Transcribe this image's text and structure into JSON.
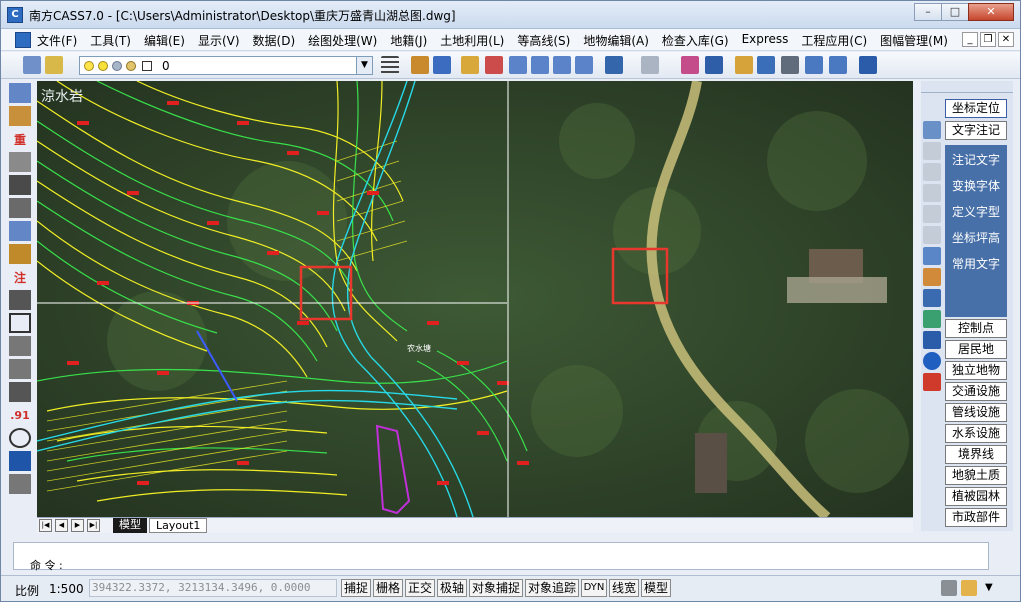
{
  "window": {
    "title": "南方CASS7.0 - [C:\\Users\\Administrator\\Desktop\\重庆万盛青山湖总图.dwg]",
    "controls": {
      "minimize": "–",
      "maximize": "□",
      "close": "✕"
    }
  },
  "menubar": {
    "items": [
      "文件(F)",
      "工具(T)",
      "编辑(E)",
      "显示(V)",
      "数据(D)",
      "绘图处理(W)",
      "地籍(J)",
      "土地利用(L)",
      "等高线(S)",
      "地物编辑(A)",
      "检查入库(G)",
      "Express",
      "工程应用(C)",
      "图幅管理(M)"
    ],
    "mdi": [
      "_",
      "❐",
      "✕"
    ]
  },
  "toolbar": {
    "layer_value": "0"
  },
  "left_toolbar": {
    "chars": [
      "重",
      "注",
      ".91"
    ]
  },
  "canvas": {
    "watermark_text": "涼水岩",
    "label_text": "农水塘"
  },
  "layout_tabs": {
    "nav": [
      "|◀",
      "◀",
      "▶",
      "▶|"
    ],
    "tabs": [
      "模型",
      "Layout1"
    ]
  },
  "right_panel": {
    "buttons_top": [
      "坐标定位",
      "文字注记"
    ],
    "text_submenu": [
      "注记文字",
      "变换字体",
      "定义字型",
      "坐标坪高",
      "常用文字"
    ],
    "buttons_bottom": [
      "控制点",
      "居民地",
      "独立地物",
      "交通设施",
      "管线设施",
      "水系设施",
      "境界线",
      "地貌土质",
      "植被园林",
      "市政部件"
    ]
  },
  "command": {
    "prompt": "命 令 :"
  },
  "statusbar": {
    "scale_label": "比例",
    "scale_value": "1:500",
    "coords": "394322.3372, 3213134.3496, 0.0000",
    "toggles": [
      "捕捉",
      "栅格",
      "正交",
      "极轴",
      "对象捕捉",
      "对象追踪",
      "DYN",
      "线宽",
      "模型"
    ]
  },
  "colors": {
    "selection_box": "#e8382e",
    "contour_yellow": "#f1ee25",
    "contour_green": "#39e04b",
    "road_cyan": "#27d8e6",
    "panel_blue": "#4870a8"
  }
}
